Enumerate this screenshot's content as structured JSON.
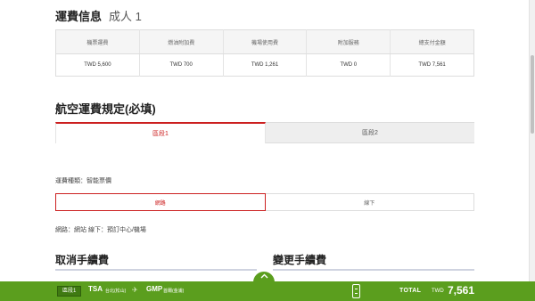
{
  "fare_info": {
    "title": "運費信息",
    "passenger": "成人 1",
    "columns": [
      "機票運費",
      "燃油附加費",
      "機場使用費",
      "附加服務",
      "總支付金額"
    ],
    "values": [
      "TWD 5,600",
      "TWD 700",
      "TWD 1,261",
      "TWD 0",
      "TWD 7,561"
    ]
  },
  "rules": {
    "title": "航空運費規定(必填)",
    "segment_tabs": [
      "區段1",
      "區段2"
    ],
    "fare_kind": "運費種類：智能票價",
    "channel_tabs": [
      "網路",
      "線下"
    ],
    "channel_note": "網路：網站 線下：預訂中心/機場"
  },
  "fees": {
    "cancel_title": "取消手續費",
    "change_title": "變更手續費"
  },
  "bottom_bar": {
    "segment_badge": "區段1",
    "from_code": "TSA",
    "from_city": "台北(松山)",
    "to_code": "GMP",
    "to_city": "首爾(金浦)",
    "total_label": "TOTAL",
    "currency": "TWD",
    "total_amount": "7,561",
    "up_icon": "chevron-up-icon",
    "color": "#5b9e1e"
  },
  "colors": {
    "accent": "#cc1f1f",
    "bar": "#5b9e1e"
  }
}
